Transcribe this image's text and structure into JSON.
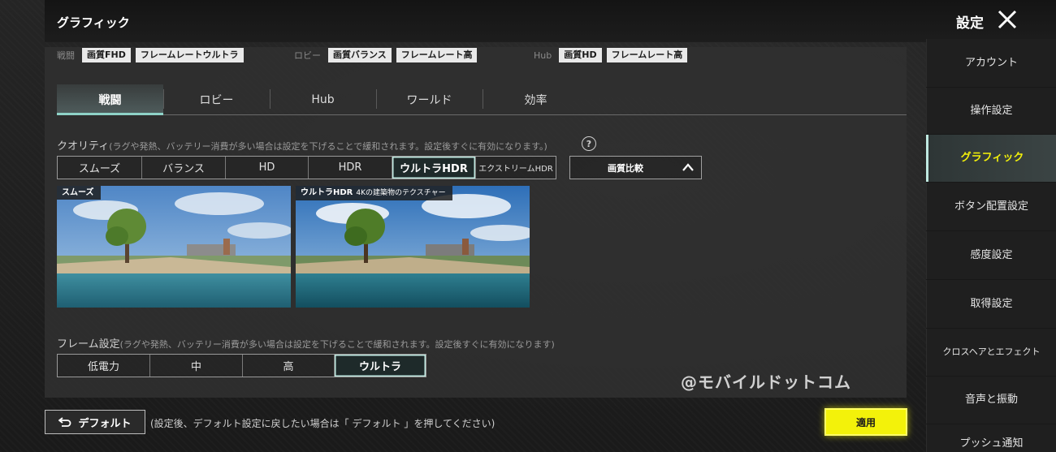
{
  "header": {
    "page_title": "グラフィック",
    "settings_title": "設定"
  },
  "summary": [
    {
      "label": "戦闘",
      "chips": [
        "画質FHD",
        "フレームレートウルトラ"
      ]
    },
    {
      "label": "ロビー",
      "chips": [
        "画質バランス",
        "フレームレート高"
      ]
    },
    {
      "label": "Hub",
      "chips": [
        "画質HD",
        "フレームレート高"
      ]
    }
  ],
  "mode_tabs": [
    "戦闘",
    "ロビー",
    "Hub",
    "ワールド",
    "効率"
  ],
  "mode_tab_active": 0,
  "quality": {
    "label": "クオリティ",
    "note": "(ラグや発熱、バッテリー消費が多い場合は設定を下げることで緩和されます。設定後すぐに有効になります。)",
    "options": [
      "スムーズ",
      "バランス",
      "HD",
      "HDR",
      "ウルトラHDR",
      "エクストリームHDR"
    ],
    "selected": "ウルトラHDR",
    "compare_label": "画質比較"
  },
  "previews": [
    {
      "tag": "スムーズ",
      "sub": ""
    },
    {
      "tag": "ウルトラHDR",
      "sub": "4Kの建築物のテクスチャー"
    }
  ],
  "frame": {
    "label": "フレーム設定",
    "note": "(ラグや発熱、バッテリー消費が多い場合は設定を下げることで緩和されます。設定後すぐに有効になります)",
    "options": [
      "低電力",
      "中",
      "高",
      "ウルトラ"
    ],
    "selected": "ウルトラ"
  },
  "watermark": "@モバイルドットコム",
  "footer": {
    "default_label": "デフォルト",
    "default_note": "(設定後、デフォルト設定に戻したい場合は「 デフォルト 」を押してください)",
    "apply_label": "適用"
  },
  "sidebar": {
    "items": [
      "アカウント",
      "操作設定",
      "グラフィック",
      "ボタン配置設定",
      "感度設定",
      "取得設定",
      "クロスヘアとエフェクト",
      "音声と振動",
      "プッシュ通知"
    ],
    "active": "グラフィック"
  },
  "colors": {
    "accent_yellow": "#f3f20a",
    "accent_teal": "#8fd3c8",
    "panel": "#303030"
  }
}
